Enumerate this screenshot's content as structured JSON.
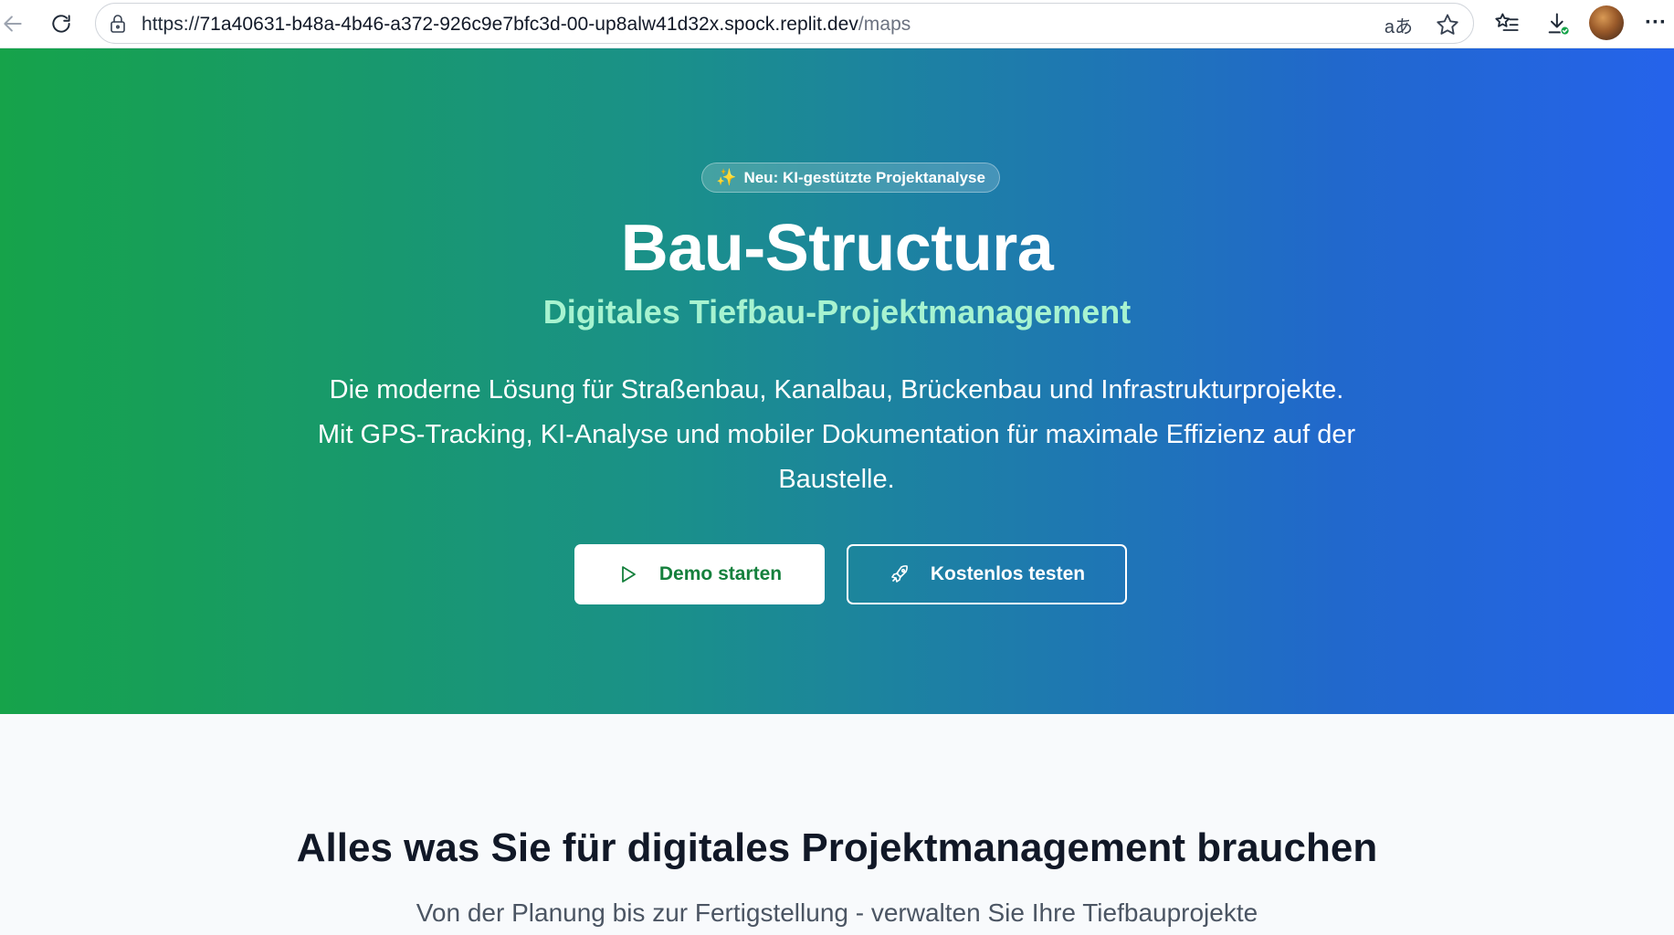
{
  "browser": {
    "url_prefix": "https://",
    "url_host": "71a40631-b48a-4b46-a372-926c9e7bfc3d-00-up8alw41d32x.spock.replit.dev",
    "url_path": "/maps",
    "translate_glyph": "aあ"
  },
  "hero": {
    "badge_icon": "✨",
    "badge_text": "Neu: KI-gestützte Projektanalyse",
    "title": "Bau-Structura",
    "subtitle": "Digitales Tiefbau-Projektmanagement",
    "description": "Die moderne Lösung für Straßenbau, Kanalbau, Brückenbau und Infrastrukturprojekte. Mit GPS-Tracking, KI-Analyse und mobiler Dokumentation für maximale Effizienz auf der Baustelle.",
    "demo_button": "Demo starten",
    "test_button": "Kostenlos testen",
    "gradient_start": "#16a34a",
    "gradient_end": "#2563eb"
  },
  "features": {
    "title": "Alles was Sie für digitales Projektmanagement brauchen",
    "subtitle": "Von der Planung bis zur Fertigstellung - verwalten Sie Ihre Tiefbauprojekte"
  }
}
